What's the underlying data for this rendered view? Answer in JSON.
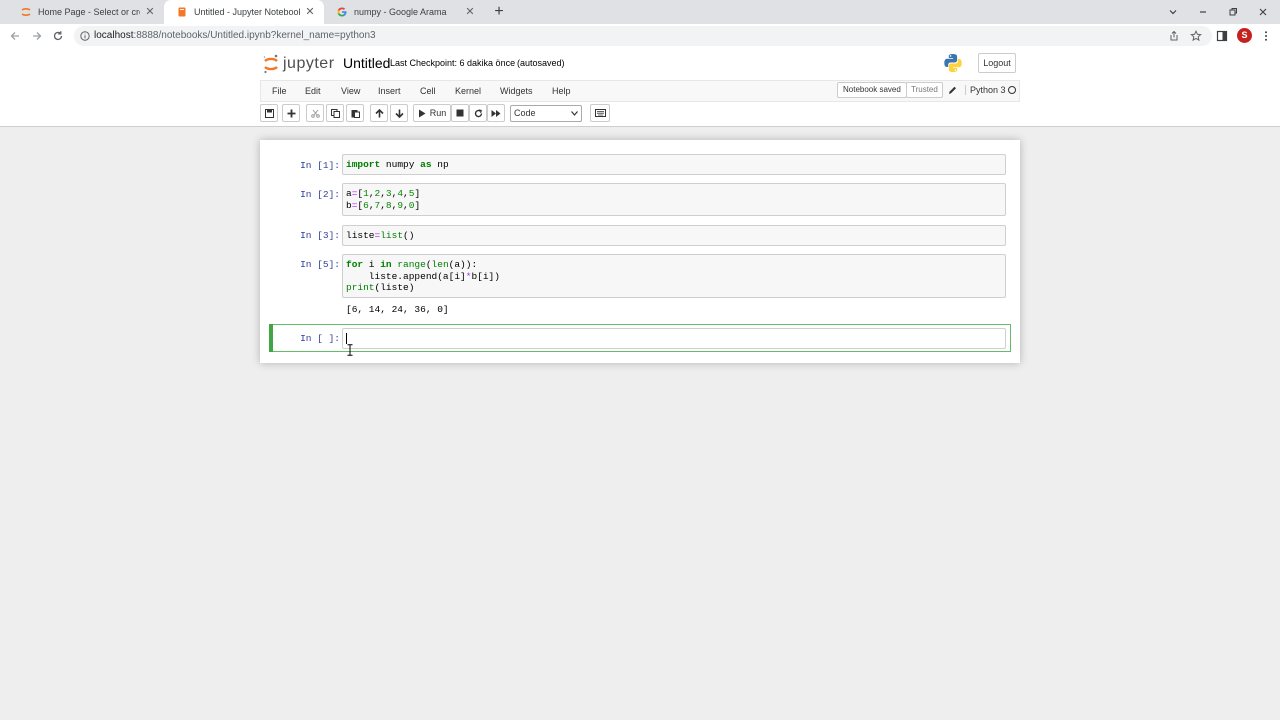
{
  "browser": {
    "tabs": [
      {
        "label": "Home Page - Select or create a n",
        "favicon": "jupyter-favicon"
      },
      {
        "label": "Untitled - Jupyter Notebook",
        "favicon": "notebook-favicon"
      },
      {
        "label": "numpy - Google Arama",
        "favicon": "google-favicon"
      }
    ],
    "url_host": "localhost",
    "url_path": ":8888/notebooks/Untitled.ipynb?kernel_name=python3",
    "profile_initial": "S"
  },
  "header": {
    "logo_text": "jupyter",
    "notebook_name": "Untitled",
    "checkpoint": "Last Checkpoint: 6 dakika önce",
    "autosaved": "(autosaved)",
    "logout_label": "Logout"
  },
  "menubar": {
    "items": [
      "File",
      "Edit",
      "View",
      "Insert",
      "Cell",
      "Kernel",
      "Widgets",
      "Help"
    ],
    "notebook_saved": "Notebook saved",
    "trusted": "Trusted",
    "kernel": "Python 3"
  },
  "toolbar": {
    "run_label": "Run",
    "cell_type": "Code"
  },
  "cells": [
    {
      "prompt": "In [1]:",
      "code": "import numpy as np",
      "output": ""
    },
    {
      "prompt": "In [2]:",
      "code": "a=[1,2,3,4,5]\nb=[6,7,8,9,0]",
      "output": ""
    },
    {
      "prompt": "In [3]:",
      "code": "liste=list()",
      "output": ""
    },
    {
      "prompt": "In [5]:",
      "code": "for i in range(len(a)):\n    liste.append(a[i]*b[i])\nprint(liste)",
      "output": "[6, 14, 24, 36, 0]"
    },
    {
      "prompt": "In [ ]:",
      "code": "",
      "output": ""
    }
  ],
  "colors": {
    "prompt": "#303f9f",
    "keyword": "#008000",
    "selected_border": "#66bb6a",
    "tabstrip": "#dfe1e5"
  }
}
